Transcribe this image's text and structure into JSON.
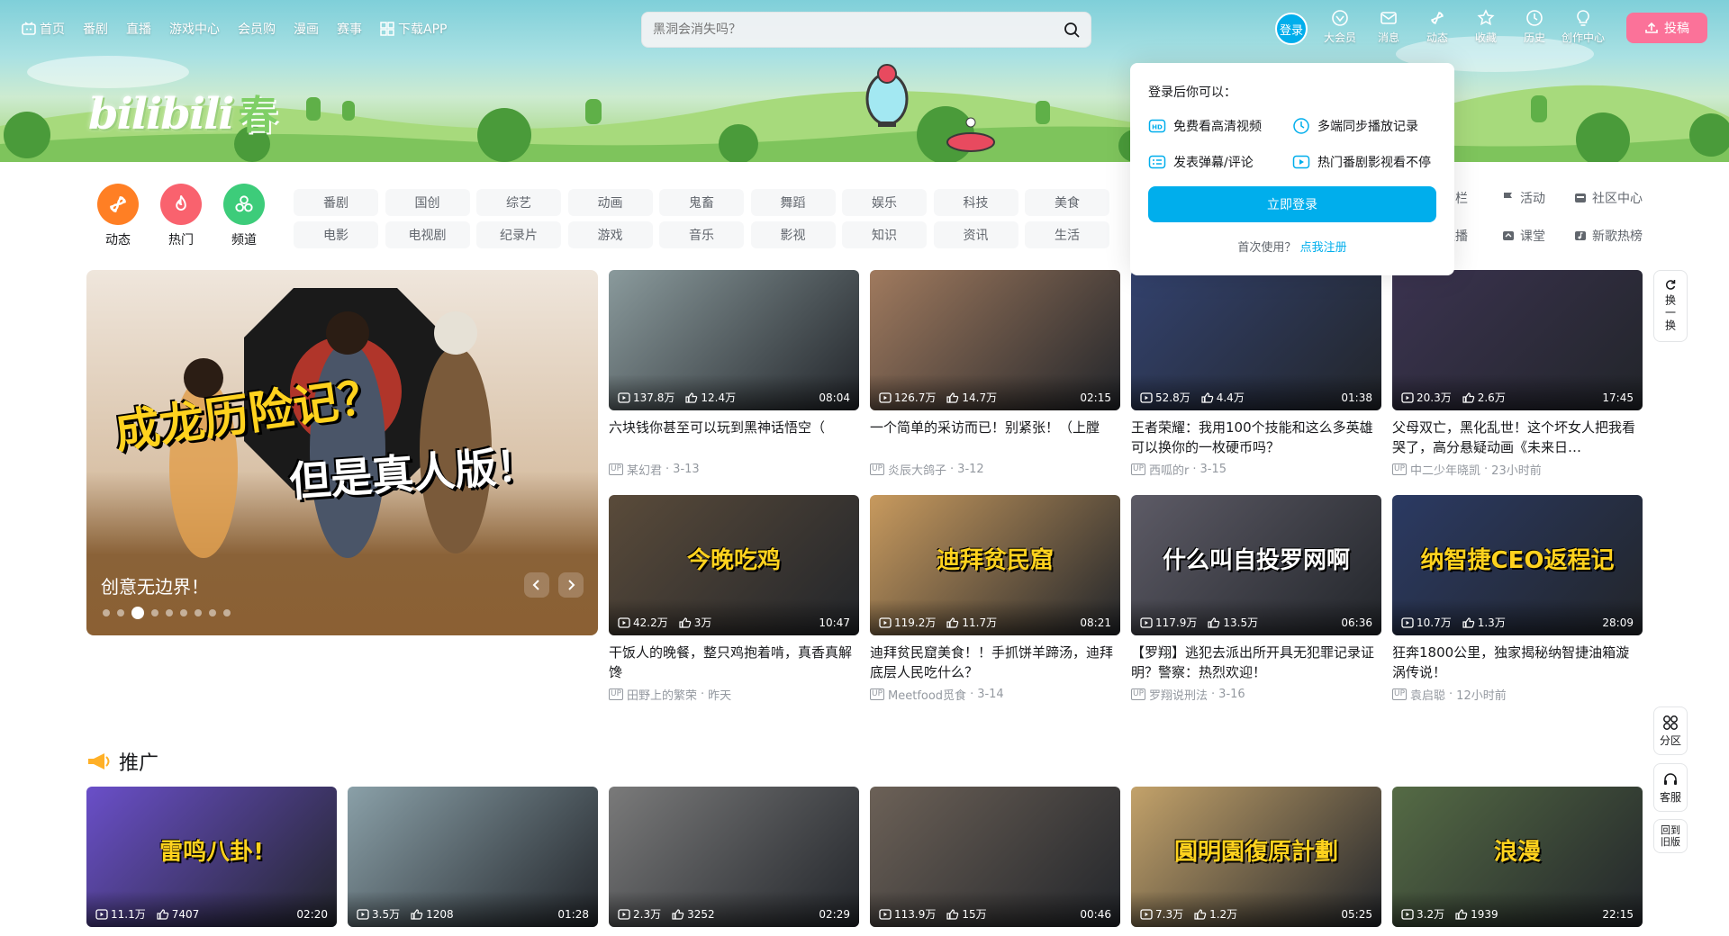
{
  "topnav": {
    "items": [
      "首页",
      "番剧",
      "直播",
      "游戏中心",
      "会员购",
      "漫画",
      "赛事",
      "下载APP"
    ]
  },
  "search": {
    "placeholder": "黑洞会消失吗？"
  },
  "header": {
    "login_label": "登录",
    "items": [
      "大会员",
      "消息",
      "动态",
      "收藏",
      "历史",
      "创作中心"
    ],
    "upload_label": "投稿",
    "logo_text": "bilibili",
    "logo_seasonal": "春"
  },
  "channels": {
    "circles": [
      {
        "label": "动态",
        "color": "#ff7f24",
        "icon": "pinwheel-icon"
      },
      {
        "label": "热门",
        "color": "#f9626e",
        "icon": "flame-icon"
      },
      {
        "label": "频道",
        "color": "#3dcc7a",
        "icon": "channels-icon"
      }
    ],
    "row1": [
      "番剧",
      "国创",
      "综艺",
      "动画",
      "鬼畜",
      "舞蹈",
      "娱乐",
      "科技",
      "美食"
    ],
    "row2": [
      "电影",
      "电视剧",
      "纪录片",
      "游戏",
      "音乐",
      "影视",
      "知识",
      "资讯",
      "生活"
    ],
    "right_row1": [
      {
        "label": "专栏",
        "icon": "column-icon"
      },
      {
        "label": "活动",
        "icon": "flag-icon"
      },
      {
        "label": "社区中心",
        "icon": "community-icon"
      }
    ],
    "right_row2": [
      {
        "label": "直播",
        "icon": "live-icon"
      },
      {
        "label": "课堂",
        "icon": "classroom-icon"
      },
      {
        "label": "新歌热榜",
        "icon": "music-chart-icon"
      }
    ]
  },
  "carousel": {
    "caption": "创意无边界！",
    "poster_line1": "成龙历险记？",
    "poster_line2": "但是真人版！",
    "dots": 9,
    "active_dot": 2
  },
  "videos": [
    {
      "views": "137.8万",
      "likes": "12.4万",
      "duration": "08:04",
      "title": "六块钱你甚至可以玩到黑神话悟空（",
      "author": "某幻君",
      "date": "3-13",
      "bg": "#8a9a9c"
    },
    {
      "views": "126.7万",
      "likes": "14.7万",
      "duration": "02:15",
      "title": "一个简单的采访而已！别紧张！（上膛",
      "author": "炎辰大鸽子",
      "date": "3-12",
      "bg": "#a07a5e"
    },
    {
      "views": "52.8万",
      "likes": "4.4万",
      "duration": "01:38",
      "title": "王者荣耀：我用100个技能和这么多英雄可以换你的一枚硬币吗？",
      "author": "西呱的r",
      "date": "3-15",
      "bg": "#33426e"
    },
    {
      "views": "20.3万",
      "likes": "2.6万",
      "duration": "17:45",
      "title": "父母双亡，黑化乱世！这个坏女人把我看哭了，高分悬疑动画《未来日…",
      "author": "中二少年晓凯",
      "date": "23小时前",
      "bg": "#3b3350"
    },
    {
      "views": "42.2万",
      "likes": "3万",
      "duration": "10:47",
      "title": "干饭人的晚餐，整只鸡抱着啃，真香真解馋",
      "author": "田野上的繁荣",
      "date": "昨天",
      "bg": "#5a4b3a",
      "overlay": "今晚吃鸡",
      "ov_color": "#ffd21e"
    },
    {
      "views": "119.2万",
      "likes": "11.7万",
      "duration": "08:21",
      "title": "迪拜贫民窟美食！！手抓饼羊蹄汤，迪拜底层人民吃什么？",
      "author": "Meetfood觅食",
      "date": "3-14",
      "bg": "#c89a5e",
      "overlay": "迪拜贫民窟",
      "ov_color": "#ffd21e"
    },
    {
      "views": "117.9万",
      "likes": "13.5万",
      "duration": "06:36",
      "title": "【罗翔】逃犯去派出所开具无犯罪记录证明？警察：热烈欢迎！",
      "author": "罗翔说刑法",
      "date": "3-16",
      "bg": "#5d5b66",
      "overlay": "什么叫自投罗网啊",
      "ov_color": "#ffffff"
    },
    {
      "views": "10.7万",
      "likes": "1.3万",
      "duration": "28:09",
      "title": "狂奔1800公里，独家揭秘纳智捷油箱漩涡传说！",
      "author": "袁启聪",
      "date": "12小时前",
      "bg": "#2b3a63",
      "overlay": "纳智捷CEO返程记",
      "ov_color": "#ffd21e"
    }
  ],
  "promo": {
    "label": "推广",
    "items": [
      {
        "views": "11.1万",
        "likes": "7407",
        "duration": "02:20",
        "bg": "#6a4fc9",
        "overlay": "雷鸣八卦!"
      },
      {
        "views": "3.5万",
        "likes": "1208",
        "duration": "01:28",
        "bg": "#8aa0a8",
        "overlay": ""
      },
      {
        "views": "2.3万",
        "likes": "3252",
        "duration": "02:29",
        "bg": "#7a7a7a",
        "overlay": ""
      },
      {
        "views": "113.9万",
        "likes": "15万",
        "duration": "00:46",
        "bg": "#6c6157",
        "overlay": ""
      },
      {
        "views": "7.3万",
        "likes": "1.2万",
        "duration": "05:25",
        "bg": "#c3a26a",
        "overlay": "圓明園復原計劃"
      },
      {
        "views": "3.2万",
        "likes": "1939",
        "duration": "22:15",
        "bg": "#556b45",
        "overlay": "浪漫"
      }
    ]
  },
  "login_popup": {
    "heading": "登录后你可以：",
    "features": [
      {
        "label": "免费看高清视频",
        "icon": "hd-icon"
      },
      {
        "label": "多端同步播放记录",
        "icon": "clock-icon"
      },
      {
        "label": "发表弹幕/评论",
        "icon": "comment-icon"
      },
      {
        "label": "热门番剧影视看不停",
        "icon": "play-box-icon"
      }
    ],
    "button": "立即登录",
    "footer_text": "首次使用？",
    "register_link": "点我注册"
  },
  "side": {
    "refresh": "换一换",
    "section": "分区",
    "service": "客服",
    "old": "回到旧版"
  }
}
